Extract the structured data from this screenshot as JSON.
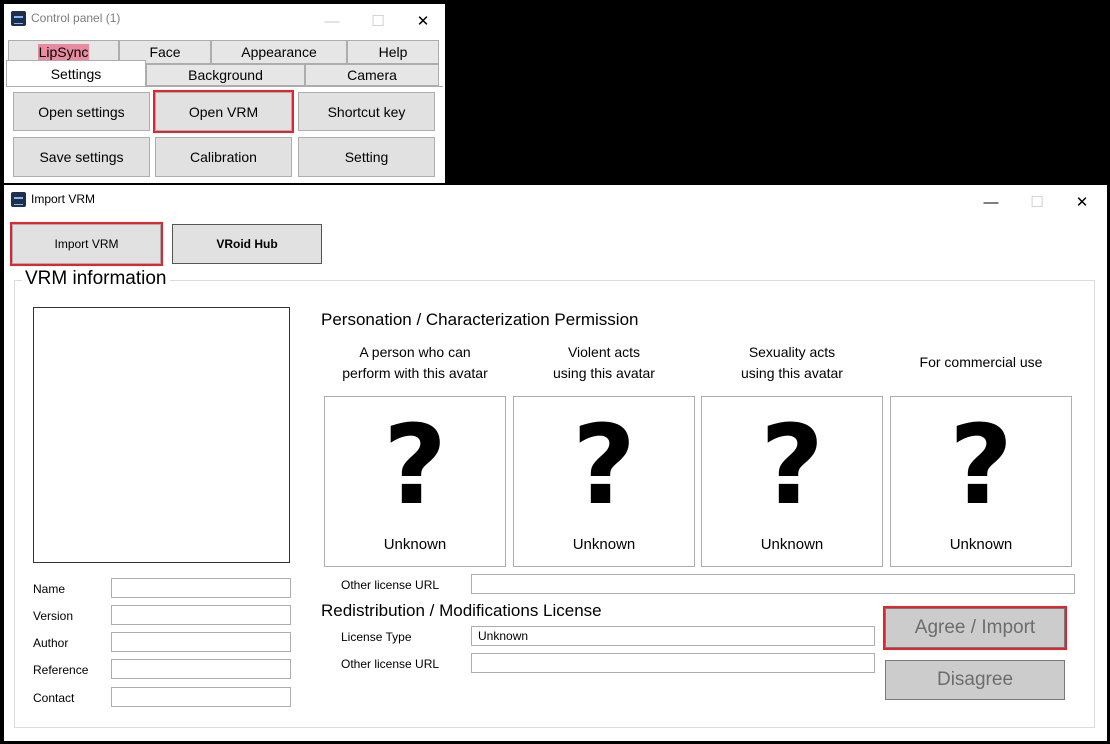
{
  "control_panel": {
    "title": "Control panel (1)",
    "tabs_row1": [
      "LipSync",
      "Face",
      "Appearance",
      "Help"
    ],
    "tabs_row2": [
      "Settings",
      "Background",
      "Camera"
    ],
    "active_tab": "Settings",
    "buttons": [
      "Open settings",
      "Open VRM",
      "Shortcut key",
      "Save settings",
      "Calibration",
      "Setting"
    ],
    "highlighted_button": "Open VRM"
  },
  "import_window": {
    "title": "Import VRM",
    "import_vrm_label": "Import VRM",
    "vroid_hub_label": "VRoid Hub",
    "group_title": "VRM information",
    "fields": {
      "name": {
        "label": "Name",
        "value": ""
      },
      "version": {
        "label": "Version",
        "value": ""
      },
      "author": {
        "label": "Author",
        "value": ""
      },
      "reference": {
        "label": "Reference",
        "value": ""
      },
      "contact": {
        "label": "Contact",
        "value": ""
      }
    },
    "personation_title": "Personation / Characterization Permission",
    "permissions": [
      {
        "heading": "A person who can\nperform with this avatar",
        "icon": "?",
        "value": "Unknown"
      },
      {
        "heading": "Violent acts\nusing this avatar",
        "icon": "?",
        "value": "Unknown"
      },
      {
        "heading": "Sexuality acts\nusing this avatar",
        "icon": "?",
        "value": "Unknown"
      },
      {
        "heading": "For commercial use",
        "icon": "?",
        "value": "Unknown"
      }
    ],
    "other_license_url_label": "Other license URL",
    "other_license_url_value": "",
    "redistribution_title": "Redistribution / Modifications License",
    "license_type_label": "License Type",
    "license_type_value": "Unknown",
    "other_license_url2_label": "Other license URL",
    "other_license_url2_value": "",
    "agree_label": "Agree / Import",
    "disagree_label": "Disagree"
  },
  "colors": {
    "highlight": "#e0262c",
    "lipsync_tab": "#e88aa0"
  }
}
